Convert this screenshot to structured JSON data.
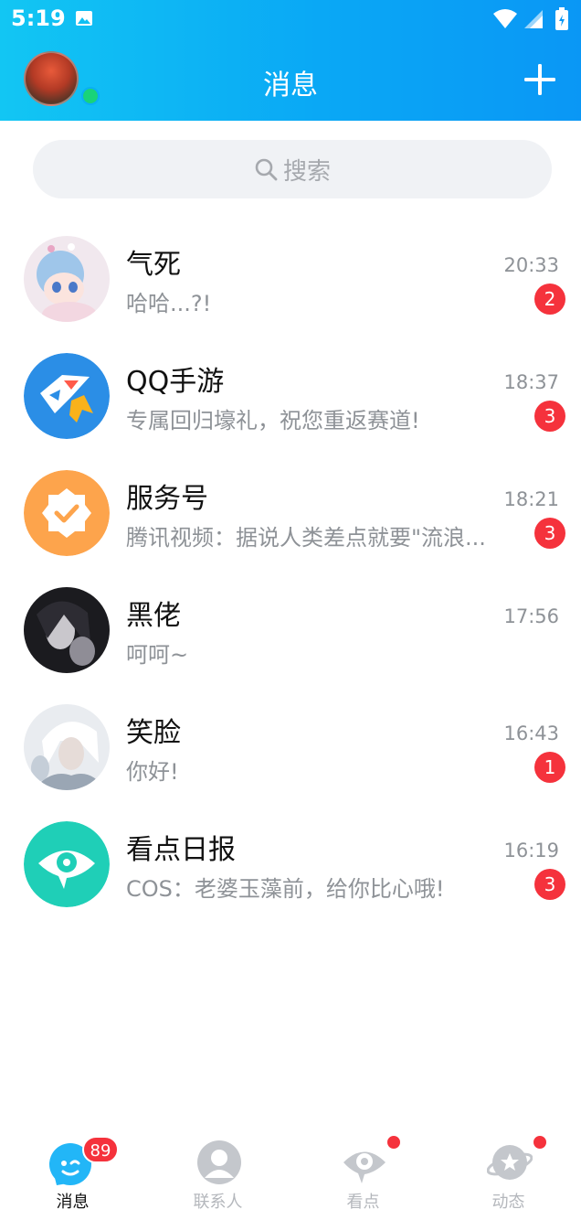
{
  "status_bar": {
    "time": "5:19"
  },
  "header": {
    "title": "消息"
  },
  "search": {
    "placeholder": "搜索"
  },
  "conversations": [
    {
      "name": "气死",
      "preview": "哈哈...?!",
      "time": "20:33",
      "unread": "2"
    },
    {
      "name": "QQ手游",
      "preview": "专属回归壕礼，祝您重返赛道!",
      "time": "18:37",
      "unread": "3"
    },
    {
      "name": "服务号",
      "preview": "腾讯视频：据说人类差点就要\"流浪...",
      "time": "18:21",
      "unread": "3"
    },
    {
      "name": "黑佬",
      "preview": "呵呵~",
      "time": "17:56",
      "unread": ""
    },
    {
      "name": "笑脸",
      "preview": "你好!",
      "time": "16:43",
      "unread": "1"
    },
    {
      "name": "看点日报",
      "preview": "COS：老婆玉藻前，给你比心哦!",
      "time": "16:19",
      "unread": "3"
    }
  ],
  "tabs": [
    {
      "label": "消息",
      "badge": "89",
      "active": true
    },
    {
      "label": "联系人"
    },
    {
      "label": "看点",
      "dot": true
    },
    {
      "label": "动态",
      "dot": true
    }
  ],
  "colors": {
    "header_start": "#12c6f3",
    "header_end": "#0a97f5",
    "badge": "#f5323c",
    "online": "#19d37a"
  }
}
